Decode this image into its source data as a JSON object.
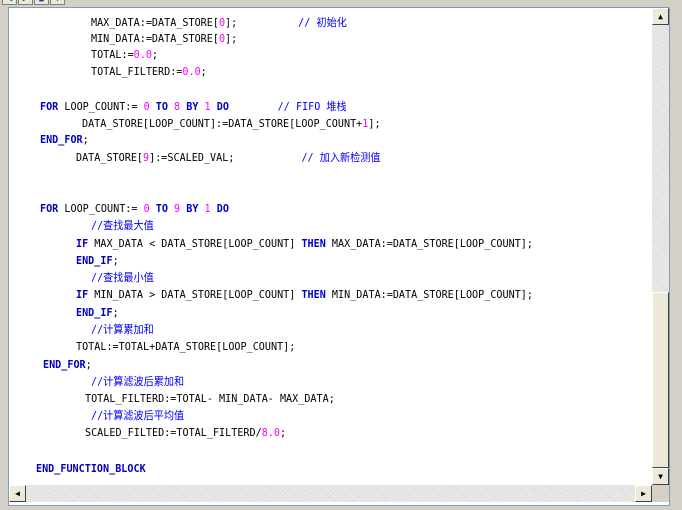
{
  "toolbar": {
    "icons": [
      "nav-left-icon",
      "nav-right-icon",
      "nav-up-icon",
      "nav-down-icon"
    ]
  },
  "code": {
    "lines": [
      [
        {
          "t": "MAX_DATA:=DATA_STORE["
        },
        {
          "t": "0",
          "c": "num"
        },
        {
          "t": "];          "
        },
        {
          "t": "// 初始化",
          "c": "cm"
        }
      ],
      [
        {
          "t": "MIN_DATA:=DATA_STORE["
        },
        {
          "t": "0",
          "c": "num"
        },
        {
          "t": "];"
        }
      ],
      [
        {
          "t": "TOTAL:="
        },
        {
          "t": "0.0",
          "c": "num"
        },
        {
          "t": ";"
        }
      ],
      [
        {
          "t": "TOTAL_FILTERD:="
        },
        {
          "t": "0.0",
          "c": "num"
        },
        {
          "t": ";"
        }
      ],
      [
        {
          "t": "FOR",
          "c": "kw"
        },
        {
          "t": " LOOP_COUNT:= "
        },
        {
          "t": "0",
          "c": "num"
        },
        {
          "t": " "
        },
        {
          "t": "TO",
          "c": "kw"
        },
        {
          "t": " "
        },
        {
          "t": "8",
          "c": "num"
        },
        {
          "t": " "
        },
        {
          "t": "BY",
          "c": "kw"
        },
        {
          "t": " "
        },
        {
          "t": "1",
          "c": "num"
        },
        {
          "t": " "
        },
        {
          "t": "DO",
          "c": "kw"
        },
        {
          "t": "        "
        },
        {
          "t": "// FIFO 堆栈",
          "c": "cm"
        }
      ],
      [
        {
          "t": "DATA_STORE[LOOP_COUNT]:=DATA_STORE[LOOP_COUNT+"
        },
        {
          "t": "1",
          "c": "num"
        },
        {
          "t": "];"
        }
      ],
      [
        {
          "t": "END_FOR",
          "c": "kw"
        },
        {
          "t": ";"
        }
      ],
      [
        {
          "t": "DATA_STORE["
        },
        {
          "t": "9",
          "c": "num"
        },
        {
          "t": "]:=SCALED_VAL;           "
        },
        {
          "t": "// 加入新检测值",
          "c": "cm"
        }
      ],
      [
        {
          "t": "FOR",
          "c": "kw"
        },
        {
          "t": " LOOP_COUNT:= "
        },
        {
          "t": "0",
          "c": "num"
        },
        {
          "t": " "
        },
        {
          "t": "TO",
          "c": "kw"
        },
        {
          "t": " "
        },
        {
          "t": "9",
          "c": "num"
        },
        {
          "t": " "
        },
        {
          "t": "BY",
          "c": "kw"
        },
        {
          "t": " "
        },
        {
          "t": "1",
          "c": "num"
        },
        {
          "t": " "
        },
        {
          "t": "DO",
          "c": "kw"
        }
      ],
      [
        {
          "t": "//查找最大值",
          "c": "cm"
        }
      ],
      [
        {
          "t": "IF",
          "c": "kw"
        },
        {
          "t": " MAX_DATA < DATA_STORE[LOOP_COUNT] "
        },
        {
          "t": "THEN",
          "c": "kw"
        },
        {
          "t": " MAX_DATA:=DATA_STORE[LOOP_COUNT];"
        }
      ],
      [
        {
          "t": "END_IF",
          "c": "kw"
        },
        {
          "t": ";"
        }
      ],
      [
        {
          "t": "//查找最小值",
          "c": "cm"
        }
      ],
      [
        {
          "t": "IF",
          "c": "kw"
        },
        {
          "t": " MIN_DATA > DATA_STORE[LOOP_COUNT] "
        },
        {
          "t": "THEN",
          "c": "kw"
        },
        {
          "t": " MIN_DATA:=DATA_STORE[LOOP_COUNT];"
        }
      ],
      [
        {
          "t": "END_IF",
          "c": "kw"
        },
        {
          "t": ";"
        }
      ],
      [
        {
          "t": "//计算累加和",
          "c": "cm"
        }
      ],
      [
        {
          "t": "TOTAL:=TOTAL+DATA_STORE[LOOP_COUNT];"
        }
      ],
      [
        {
          "t": "END_FOR",
          "c": "kw"
        },
        {
          "t": ";"
        }
      ],
      [
        {
          "t": "//计算滤波后累加和",
          "c": "cm"
        }
      ],
      [
        {
          "t": "TOTAL_FILTERD:=TOTAL- MIN_DATA- MAX_DATA;"
        }
      ],
      [
        {
          "t": "//计算滤波后平均值",
          "c": "cm"
        }
      ],
      [
        {
          "t": "SCALED_FILTED:=TOTAL_FILTERD/"
        },
        {
          "t": "8.0",
          "c": "num"
        },
        {
          "t": ";"
        }
      ],
      [
        {
          "t": "END_FUNCTION_BLOCK",
          "c": "kw"
        }
      ]
    ]
  },
  "scrollbars": {
    "vertical": {
      "up_icon": "arrow-up-icon",
      "down_icon": "arrow-down-icon"
    },
    "horizontal": {
      "left_icon": "arrow-left-icon",
      "right_icon": "arrow-right-icon"
    }
  }
}
